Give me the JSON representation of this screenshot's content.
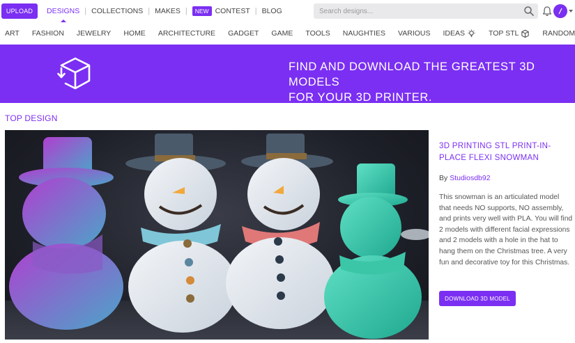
{
  "header": {
    "upload_label": "UPLOAD",
    "nav": [
      {
        "label": "DESIGNS",
        "active": true
      },
      {
        "label": "COLLECTIONS"
      },
      {
        "label": "MAKES"
      },
      {
        "label": "CONTEST",
        "badge": "NEW"
      },
      {
        "label": "BLOG"
      }
    ],
    "search_placeholder": "Search designs..."
  },
  "categories": [
    "ART",
    "FASHION",
    "JEWELRY",
    "HOME",
    "ARCHITECTURE",
    "GADGET",
    "GAME",
    "TOOLS",
    "NAUGHTIES",
    "VARIOUS",
    "IDEAS",
    "TOP STL",
    "RANDOM"
  ],
  "banner": {
    "line1": "FIND AND DOWNLOAD THE GREATEST 3D MODELS",
    "line2": "FOR YOUR 3D PRINTER."
  },
  "top_design": {
    "section_title": "TOP DESIGN",
    "title": "3D PRINTING STL PRINT-IN-PLACE FLEXI SNOWMAN",
    "by_prefix": "By",
    "author": "Studiosdb92",
    "description": "This snowman is an articulated model that needs NO supports, NO assembly, and prints very well with PLA. You will find 2 models with different facial expressions and 2 models with a hole in the hat to hang them on the Christmas tree. A very fun and decorative toy for this Christmas.",
    "download_label": "DOWNLOAD 3D MODEL"
  },
  "colors": {
    "accent": "#7b2ff2",
    "search_bg": "#e9e9ec"
  },
  "icons": {
    "search": "search-icon",
    "bell": "bell-icon",
    "banner_logo": "cube-download-icon",
    "ideas": "lightbulb-icon",
    "top_stl": "cube-icon",
    "random": "shuffle-icon"
  }
}
